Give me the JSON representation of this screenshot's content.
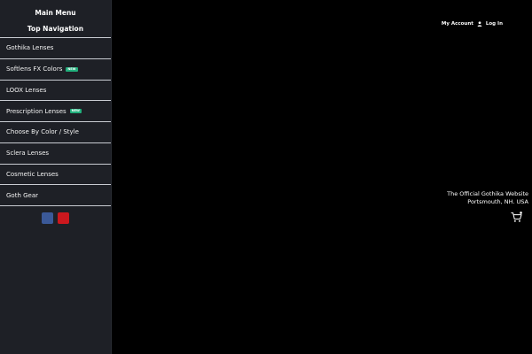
{
  "sidebar": {
    "main_menu_title": "Main Menu",
    "top_navigation_title": "Top Navigation",
    "items": [
      {
        "label": "Gothika Lenses"
      },
      {
        "label": "Softlens FX Colors",
        "badge": "NEW"
      },
      {
        "label": "LOOX Lenses"
      },
      {
        "label": "Prescription Lenses",
        "badge": "NEW"
      },
      {
        "label": "Choose By Color / Style"
      },
      {
        "label": "Sclera Lenses"
      },
      {
        "label": "Cosmetic Lenses"
      },
      {
        "label": "Goth Gear"
      }
    ],
    "social": [
      {
        "icon": "facebook-icon",
        "color": "#3b5998"
      },
      {
        "icon": "youtube-icon",
        "color": "#cc181e"
      }
    ]
  },
  "header": {
    "my_account": "My Account",
    "log_in": "Log In"
  },
  "tagline": {
    "line1": "The Official Gothika Website",
    "line2": "Portsmouth, NH. USA"
  },
  "colors": {
    "background": "#000000",
    "sidebar": "#1e2026",
    "badge": "#22b07d",
    "text": "#ffffff"
  }
}
